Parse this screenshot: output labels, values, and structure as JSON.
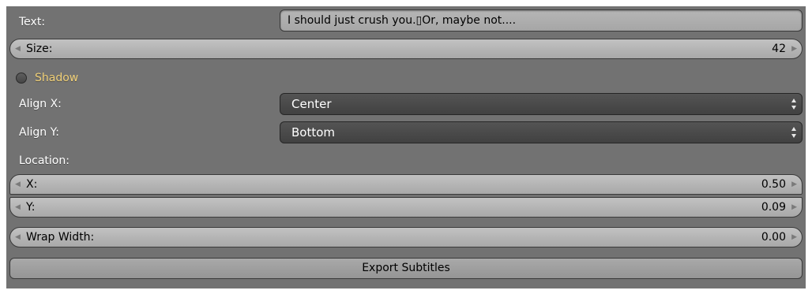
{
  "text_field": {
    "label": "Text:",
    "value": "I should just crush you.▯Or, maybe not...."
  },
  "size_field": {
    "label": "Size:",
    "value": "42"
  },
  "shadow": {
    "label": "Shadow",
    "checked": false,
    "label_color": "#f0d078"
  },
  "align_x": {
    "label": "Align X:",
    "value": "Center"
  },
  "align_y": {
    "label": "Align Y:",
    "value": "Bottom"
  },
  "location": {
    "label": "Location:",
    "x": {
      "label": "X:",
      "value": "0.50"
    },
    "y": {
      "label": "Y:",
      "value": "0.09"
    }
  },
  "wrap_width": {
    "label": "Wrap Width:",
    "value": "0.00"
  },
  "export_button": {
    "label": "Export Subtitles"
  },
  "colors": {
    "panel": "#727272",
    "dropdown": "#4a4a4a",
    "field": "#b0b0b0"
  }
}
